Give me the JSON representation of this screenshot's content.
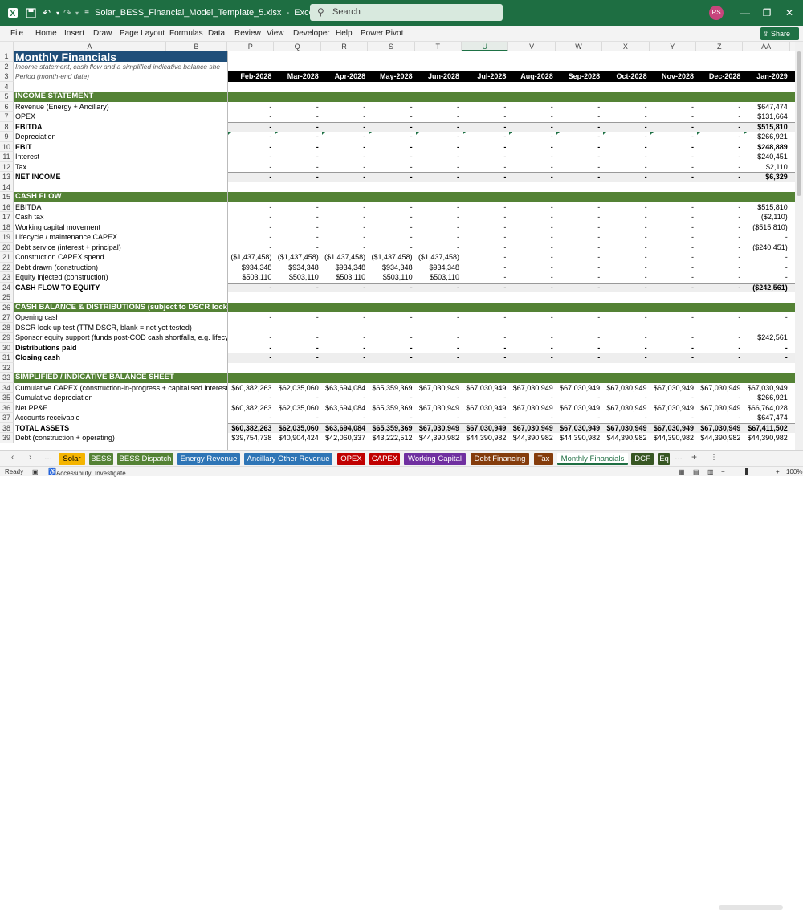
{
  "titlebar": {
    "filename": "Solar_BESS_Financial_Model_Template_5.xlsx",
    "app": "Excel",
    "search_placeholder": "Search",
    "avatar": "RS"
  },
  "menu": [
    "File",
    "Home",
    "Insert",
    "Draw",
    "Page Layout",
    "Formulas",
    "Data",
    "Review",
    "View",
    "Developer",
    "Help",
    "Power Pivot"
  ],
  "share_label": "Share",
  "columns": [
    {
      "id": "A",
      "w": 266
    },
    {
      "id": "B",
      "w": 0
    }
  ],
  "col_headers_right": [
    "P",
    "Q",
    "R",
    "S",
    "T",
    "U",
    "V",
    "W",
    "X",
    "Y",
    "Z",
    "AA"
  ],
  "selected_col": "U",
  "rows": [
    {
      "n": "1",
      "a": "Monthly Financials",
      "style": "title"
    },
    {
      "n": "2",
      "a": "Income statement, cash flow and a simplified indicative balance she",
      "style": "ital"
    },
    {
      "n": "3",
      "a": "Period (month-end date)",
      "style": "ital dark",
      "v": [
        "Feb-2028",
        "Mar-2028",
        "Apr-2028",
        "May-2028",
        "Jun-2028",
        "Jul-2028",
        "Aug-2028",
        "Sep-2028",
        "Oct-2028",
        "Nov-2028",
        "Dec-2028",
        "Jan-2029"
      ]
    },
    {
      "n": "4",
      "a": ""
    },
    {
      "n": "5",
      "a": "INCOME STATEMENT",
      "style": "section"
    },
    {
      "n": "6",
      "a": "Revenue (Energy + Ancillary)",
      "v": [
        "-",
        "-",
        "-",
        "-",
        "-",
        "-",
        "-",
        "-",
        "-",
        "-",
        "-",
        "$647,474"
      ]
    },
    {
      "n": "7",
      "a": "OPEX",
      "v": [
        "-",
        "-",
        "-",
        "-",
        "-",
        "-",
        "-",
        "-",
        "-",
        "-",
        "-",
        "$131,664"
      ]
    },
    {
      "n": "8",
      "a": "EBITDA",
      "style": "bold shade",
      "v": [
        "-",
        "-",
        "-",
        "-",
        "-",
        "-",
        "-",
        "-",
        "-",
        "-",
        "-",
        "$515,810"
      ]
    },
    {
      "n": "9",
      "a": "Depreciation",
      "tri": true,
      "v": [
        "-",
        "-",
        "-",
        "-",
        "-",
        "-",
        "-",
        "-",
        "-",
        "-",
        "-",
        "$266,921"
      ]
    },
    {
      "n": "10",
      "a": "EBIT",
      "style": "bold",
      "v": [
        "-",
        "-",
        "-",
        "-",
        "-",
        "-",
        "-",
        "-",
        "-",
        "-",
        "-",
        "$248,889"
      ]
    },
    {
      "n": "11",
      "a": "Interest",
      "v": [
        "-",
        "-",
        "-",
        "-",
        "-",
        "-",
        "-",
        "-",
        "-",
        "-",
        "-",
        "$240,451"
      ]
    },
    {
      "n": "12",
      "a": "Tax",
      "v": [
        "-",
        "-",
        "-",
        "-",
        "-",
        "-",
        "-",
        "-",
        "-",
        "-",
        "-",
        "$2,110"
      ]
    },
    {
      "n": "13",
      "a": "NET INCOME",
      "style": "bold shade",
      "v": [
        "-",
        "-",
        "-",
        "-",
        "-",
        "-",
        "-",
        "-",
        "-",
        "-",
        "-",
        "$6,329"
      ]
    },
    {
      "n": "14",
      "a": ""
    },
    {
      "n": "15",
      "a": "CASH FLOW",
      "style": "section"
    },
    {
      "n": "16",
      "a": "EBITDA",
      "v": [
        "-",
        "-",
        "-",
        "-",
        "-",
        "-",
        "-",
        "-",
        "-",
        "-",
        "-",
        "$515,810"
      ]
    },
    {
      "n": "17",
      "a": "Cash tax",
      "v": [
        "-",
        "-",
        "-",
        "-",
        "-",
        "-",
        "-",
        "-",
        "-",
        "-",
        "-",
        "($2,110)"
      ]
    },
    {
      "n": "18",
      "a": "Working capital movement",
      "v": [
        "-",
        "-",
        "-",
        "-",
        "-",
        "-",
        "-",
        "-",
        "-",
        "-",
        "-",
        "($515,810)"
      ]
    },
    {
      "n": "19",
      "a": "Lifecycle / maintenance CAPEX",
      "v": [
        "-",
        "-",
        "-",
        "-",
        "-",
        "-",
        "-",
        "-",
        "-",
        "-",
        "-",
        "-"
      ]
    },
    {
      "n": "20",
      "a": "Debt service (interest + principal)",
      "v": [
        "-",
        "-",
        "-",
        "-",
        "-",
        "-",
        "-",
        "-",
        "-",
        "-",
        "-",
        "($240,451)"
      ]
    },
    {
      "n": "21",
      "a": "Construction CAPEX spend",
      "v": [
        "($1,437,458)",
        "($1,437,458)",
        "($1,437,458)",
        "($1,437,458)",
        "($1,437,458)",
        "-",
        "-",
        "-",
        "-",
        "-",
        "-",
        "-"
      ]
    },
    {
      "n": "22",
      "a": "Debt drawn (construction)",
      "v": [
        "$934,348",
        "$934,348",
        "$934,348",
        "$934,348",
        "$934,348",
        "-",
        "-",
        "-",
        "-",
        "-",
        "-",
        "-"
      ]
    },
    {
      "n": "23",
      "a": "Equity injected (construction)",
      "v": [
        "$503,110",
        "$503,110",
        "$503,110",
        "$503,110",
        "$503,110",
        "-",
        "-",
        "-",
        "-",
        "-",
        "-",
        "-"
      ]
    },
    {
      "n": "24",
      "a": "CASH FLOW TO EQUITY",
      "style": "bold shade",
      "v": [
        "-",
        "-",
        "-",
        "-",
        "-",
        "-",
        "-",
        "-",
        "-",
        "-",
        "-",
        "($242,561)"
      ]
    },
    {
      "n": "25",
      "a": ""
    },
    {
      "n": "26",
      "a": "CASH BALANCE & DISTRIBUTIONS (subject to DSCR lock-",
      "style": "section"
    },
    {
      "n": "27",
      "a": "Opening cash",
      "v": [
        "-",
        "-",
        "-",
        "-",
        "-",
        "-",
        "-",
        "-",
        "-",
        "-",
        "-",
        "-"
      ]
    },
    {
      "n": "28",
      "a": "DSCR lock-up test (TTM DSCR, blank = not yet tested)",
      "v": [
        "",
        "",
        "",
        "",
        "",
        "",
        "",
        "",
        "",
        "",
        "",
        ""
      ]
    },
    {
      "n": "29",
      "a": "Sponsor equity support (funds post-COD cash shortfalls, e.g. lifecycle",
      "v": [
        "-",
        "-",
        "-",
        "-",
        "-",
        "-",
        "-",
        "-",
        "-",
        "-",
        "-",
        "$242,561"
      ]
    },
    {
      "n": "30",
      "a": "Distributions paid",
      "style": "bold",
      "v": [
        "-",
        "-",
        "-",
        "-",
        "-",
        "-",
        "-",
        "-",
        "-",
        "-",
        "-",
        "-"
      ]
    },
    {
      "n": "31",
      "a": "Closing cash",
      "style": "bold shade",
      "v": [
        "-",
        "-",
        "-",
        "-",
        "-",
        "-",
        "-",
        "-",
        "-",
        "-",
        "-",
        "-"
      ]
    },
    {
      "n": "32",
      "a": ""
    },
    {
      "n": "33",
      "a": "SIMPLIFIED / INDICATIVE BALANCE SHEET",
      "style": "section"
    },
    {
      "n": "34",
      "a": "Cumulative CAPEX (construction-in-progress + capitalised interest +",
      "v": [
        "$60,382,263",
        "$62,035,060",
        "$63,694,084",
        "$65,359,369",
        "$67,030,949",
        "$67,030,949",
        "$67,030,949",
        "$67,030,949",
        "$67,030,949",
        "$67,030,949",
        "$67,030,949",
        "$67,030,949"
      ]
    },
    {
      "n": "35",
      "a": "Cumulative depreciation",
      "v": [
        "-",
        "-",
        "-",
        "-",
        "-",
        "-",
        "-",
        "-",
        "-",
        "-",
        "-",
        "$266,921"
      ]
    },
    {
      "n": "36",
      "a": "Net PP&E",
      "v": [
        "$60,382,263",
        "$62,035,060",
        "$63,694,084",
        "$65,359,369",
        "$67,030,949",
        "$67,030,949",
        "$67,030,949",
        "$67,030,949",
        "$67,030,949",
        "$67,030,949",
        "$67,030,949",
        "$66,764,028"
      ]
    },
    {
      "n": "37",
      "a": "Accounts receivable",
      "v": [
        "-",
        "-",
        "-",
        "-",
        "-",
        "-",
        "-",
        "-",
        "-",
        "-",
        "-",
        "$647,474"
      ]
    },
    {
      "n": "38",
      "a": "TOTAL ASSETS",
      "style": "bold shade",
      "v": [
        "$60,382,263",
        "$62,035,060",
        "$63,694,084",
        "$65,359,369",
        "$67,030,949",
        "$67,030,949",
        "$67,030,949",
        "$67,030,949",
        "$67,030,949",
        "$67,030,949",
        "$67,030,949",
        "$67,411,502"
      ]
    },
    {
      "n": "39",
      "a": "Debt (construction + operating)",
      "v": [
        "$39,754,738",
        "$40,904,424",
        "$42,060,337",
        "$43,222,512",
        "$44,390,982",
        "$44,390,982",
        "$44,390,982",
        "$44,390,982",
        "$44,390,982",
        "$44,390,982",
        "$44,390,982",
        "$44,390,982"
      ]
    }
  ],
  "tabs": [
    {
      "label": "Solar",
      "color": "#f4b400",
      "text": "#000"
    },
    {
      "label": "BESS",
      "color": "#548235",
      "text": "#fff"
    },
    {
      "label": "BESS Dispatch",
      "color": "#548235",
      "text": "#fff"
    },
    {
      "label": "Energy Revenue",
      "color": "#2e75b6",
      "text": "#fff"
    },
    {
      "label": "Ancillary Other Revenue",
      "color": "#2e75b6",
      "text": "#fff"
    },
    {
      "label": "OPEX",
      "color": "#c00000",
      "text": "#fff"
    },
    {
      "label": "CAPEX",
      "color": "#c00000",
      "text": "#fff"
    },
    {
      "label": "Working Capital",
      "color": "#7030a0",
      "text": "#fff"
    },
    {
      "label": "Debt Financing",
      "color": "#843c0c",
      "text": "#fff"
    },
    {
      "label": "Tax",
      "color": "#843c0c",
      "text": "#fff"
    },
    {
      "label": "Monthly Financials",
      "color": "#ffffff",
      "text": "#1e6e42",
      "active": true
    },
    {
      "label": "DCF",
      "color": "#375623",
      "text": "#fff"
    },
    {
      "label": "Eq",
      "color": "#375623",
      "text": "#fff"
    }
  ],
  "status": {
    "ready": "Ready",
    "accessibility": "Accessibility: Investigate",
    "zoom": "100%"
  }
}
